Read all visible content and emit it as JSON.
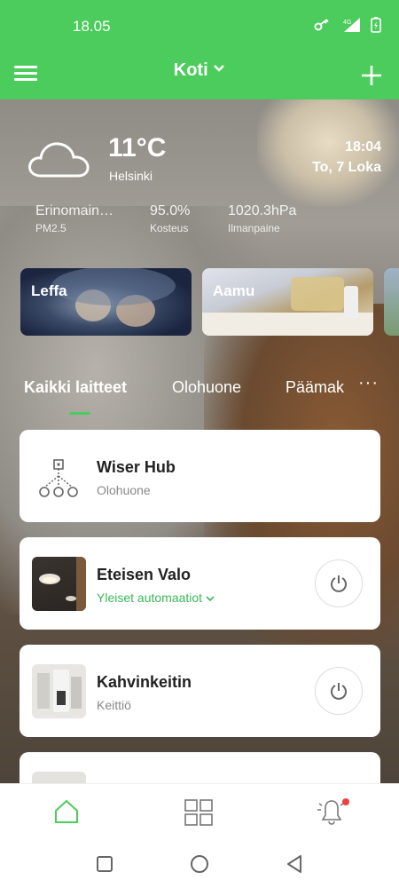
{
  "status_bar": {
    "time": "18.05",
    "network": "4G"
  },
  "app_bar": {
    "title": "Koti"
  },
  "weather": {
    "temperature": "11°C",
    "city": "Helsinki",
    "time": "18:04",
    "date": "To, 7 Loka",
    "metrics": [
      {
        "value": "Erinomain…",
        "label": "PM2.5"
      },
      {
        "value": "95.0%",
        "label": "Kosteus"
      },
      {
        "value": "1020.3hPa",
        "label": "Ilmanpaine"
      }
    ]
  },
  "scenes": [
    {
      "label": "Leffa"
    },
    {
      "label": "Aamu"
    }
  ],
  "tabs": {
    "items": [
      "Kaikki laitteet",
      "Olohuone",
      "Päämak"
    ],
    "active": "Kaikki laitteet",
    "more": "···"
  },
  "devices": [
    {
      "name": "Wiser Hub",
      "room": "Olohuone"
    },
    {
      "name": "Eteisen Valo",
      "room": "Yleiset automaatiot"
    },
    {
      "name": "Kahvinkeitin",
      "room": "Keittiö"
    }
  ],
  "colors": {
    "accent": "#4ccc5c",
    "notification": "#f04040"
  }
}
